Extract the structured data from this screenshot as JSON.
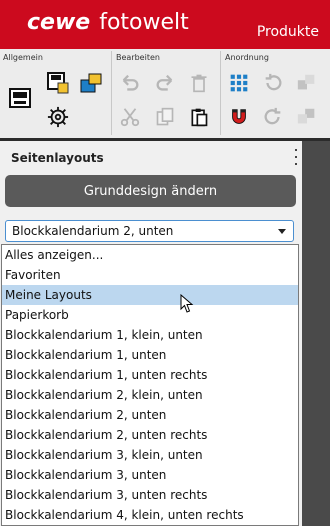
{
  "header": {
    "brand": "cewe",
    "app_name": "fotowelt",
    "menu_products": "Produkte"
  },
  "toolbar": {
    "groups": {
      "allgemein": "Allgemein",
      "bearbeiten": "Bearbeiten",
      "anordnung": "Anordnung"
    }
  },
  "panel": {
    "title": "Seitenlayouts",
    "base_design_button": "Grunddesign ändern",
    "layout_select": {
      "selected": "Blockkalendarium 2, unten"
    }
  },
  "dropdown": {
    "hovered_index": 2,
    "items": [
      "Alles anzeigen...",
      "Favoriten",
      "Meine Layouts",
      "Papierkorb",
      "Blockkalendarium 1, klein, unten",
      "Blockkalendarium 1, unten",
      "Blockkalendarium 1, unten rechts",
      "Blockkalendarium 2, klein, unten",
      "Blockkalendarium 2, unten",
      "Blockkalendarium 2, unten rechts",
      "Blockkalendarium 3, klein, unten",
      "Blockkalendarium 3, unten",
      "Blockkalendarium 3, unten rechts",
      "Blockkalendarium 4, klein, unten rechts"
    ]
  },
  "colors": {
    "brand_red": "#cc0a1e",
    "hover_blue": "#bcd7ef",
    "select_border": "#4b8fd0"
  }
}
